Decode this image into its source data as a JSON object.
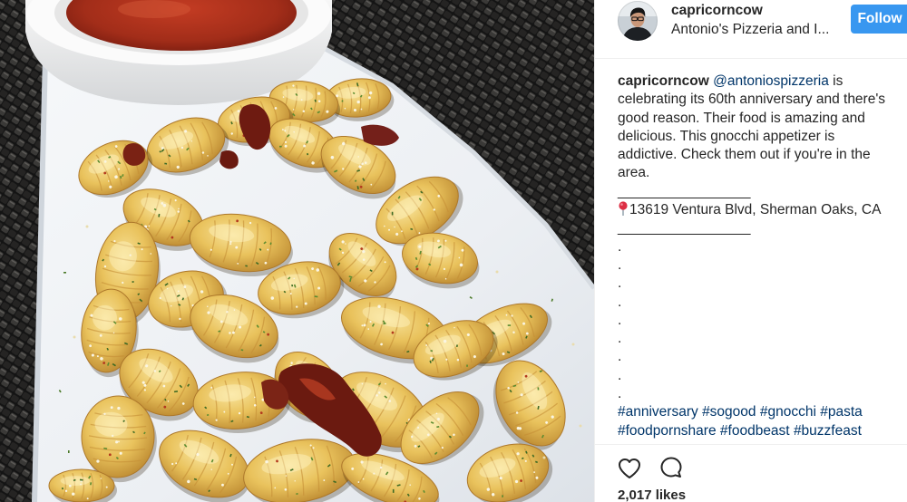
{
  "post": {
    "author": {
      "username": "capricorncow",
      "location": "Antonio's Pizzeria and I..."
    },
    "follow_label": "Follow",
    "caption": {
      "username": "capricorncow",
      "mention": "@antoniospizzeria",
      "first_line_text": "is",
      "lines": [
        "celebrating its 60th anniversary and there's",
        "good reason. Their food is amazing and",
        "delicious. This gnocchi appetizer is",
        "addictive. Check them out if you're in the",
        "area."
      ],
      "separator": "_________________",
      "location_pin_icon": "round-pushpin-icon",
      "address": "13619 Ventura Blvd, Sherman Oaks, CA",
      "dots": [
        ".",
        ".",
        ".",
        ".",
        ".",
        ".",
        ".",
        ".",
        "."
      ],
      "hashtags": [
        "#anniversary",
        "#sogood",
        "#gnocchi",
        "#pasta",
        "#foodpornshare",
        "#foodbeast",
        "#buzzfeast"
      ]
    },
    "actions": {
      "like_icon": "heart-icon",
      "comment_icon": "comment-icon"
    },
    "likes": "2,017 likes"
  },
  "colors": {
    "text": "#262626",
    "link": "#003569",
    "follow_button": "#3897f0",
    "divider": "#efefef"
  }
}
